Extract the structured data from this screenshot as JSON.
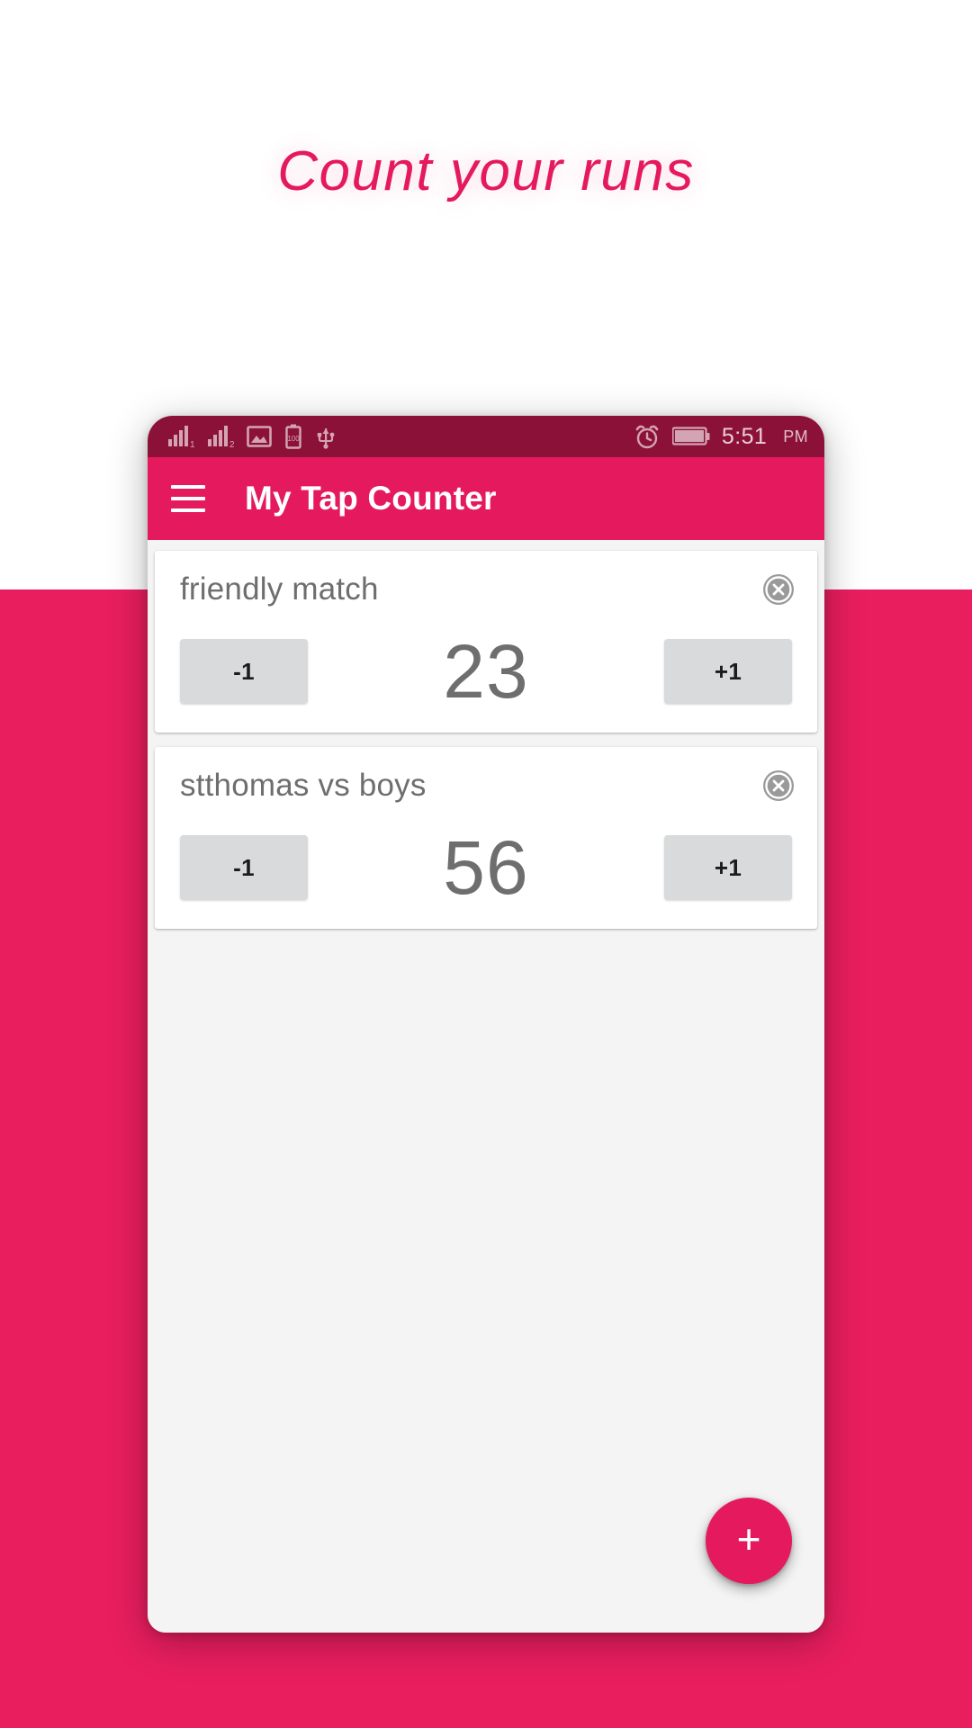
{
  "promo": {
    "headline": "Count your runs",
    "headline_color": "#e5195e",
    "background_color": "#ffffff",
    "band_color": "#e91e5f"
  },
  "phone": {
    "statusbar": {
      "background_color": "#8c1139",
      "time": "5:51",
      "ampm": "PM",
      "battery_level_label": "100",
      "left_icons": [
        "signal-bars-1-icon",
        "signal-bars-2-icon",
        "image-icon",
        "battery-vertical-icon",
        "usb-icon"
      ],
      "right_icons": [
        "alarm-clock-icon",
        "battery-icon"
      ]
    },
    "appbar": {
      "background_color": "#e5195e",
      "menu_icon": "hamburger-menu-icon",
      "title": "My Tap Counter"
    },
    "body": {
      "background_color": "#f4f4f4",
      "counters": [
        {
          "title": "friendly match",
          "value": "23",
          "decrement_label": "-1",
          "increment_label": "+1",
          "delete_icon": "close-circle-icon"
        },
        {
          "title": "stthomas vs boys",
          "value": "56",
          "decrement_label": "-1",
          "increment_label": "+1",
          "delete_icon": "close-circle-icon"
        }
      ],
      "fab": {
        "label": "+",
        "color": "#e5195e",
        "icon": "plus-icon"
      }
    }
  }
}
